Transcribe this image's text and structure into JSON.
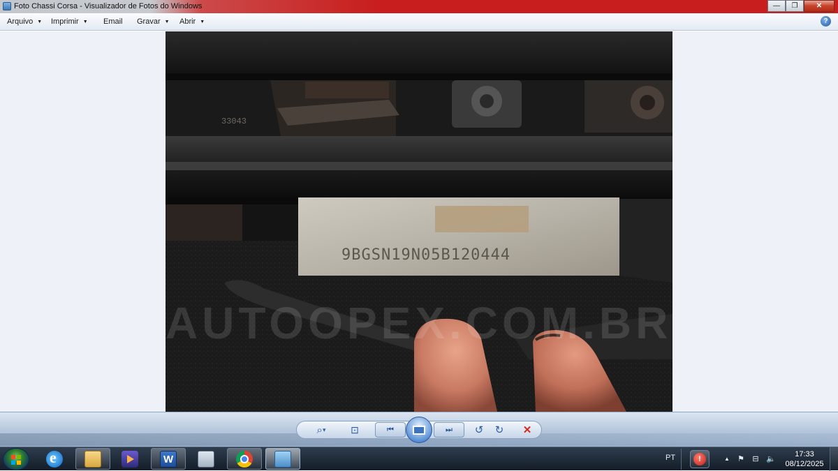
{
  "window": {
    "title": "Foto Chassi Corsa - Visualizador de Fotos do Windows",
    "controls": {
      "minimize": "—",
      "maximize": "❐",
      "close": "✕"
    }
  },
  "menu": {
    "items": [
      {
        "label": "Arquivo",
        "has_arrow": true
      },
      {
        "label": "Imprimir",
        "has_arrow": true
      },
      {
        "label": "Email",
        "has_arrow": false
      },
      {
        "label": "Gravar",
        "has_arrow": true
      },
      {
        "label": "Abrir",
        "has_arrow": true
      }
    ],
    "arrow_glyph": "▼",
    "help_glyph": "?"
  },
  "photo": {
    "vin_plate_text": "9BGSN19N05B120444",
    "rail_stamp_text": "33043",
    "watermark_text": "AUTOOPEX.COM.BR"
  },
  "toolbar": {
    "icons": [
      "zoom-icon",
      "fit-window-icon",
      "previous-icon",
      "slideshow-icon",
      "next-icon",
      "rotate-left-icon",
      "rotate-right-icon",
      "delete-icon"
    ],
    "zoom_glyph": "⌕",
    "zoom_arrow": "▾",
    "fit_glyph": "⊡",
    "prev_glyph": "⏮",
    "next_glyph": "⏭",
    "rotate_left_glyph": "↺",
    "rotate_right_glyph": "↻",
    "delete_glyph": "✕"
  },
  "taskbar": {
    "apps": [
      "internet-explorer-icon",
      "file-explorer-icon",
      "media-player-icon",
      "word-icon",
      "calculator-icon",
      "chrome-icon",
      "photo-viewer-icon"
    ],
    "language": "PT",
    "tray_badge": "!",
    "clock_time": "17:33",
    "clock_date": "08/12/2025",
    "tray_up_glyph": "▲",
    "tray_flag_glyph": "⚑",
    "tray_network_glyph": "⊟",
    "tray_volume_glyph": "🔈"
  },
  "colors": {
    "titlebar_accent": "#c81e1e",
    "viewer_background": "#eef2f8",
    "taskbar": "#1e2a38"
  }
}
